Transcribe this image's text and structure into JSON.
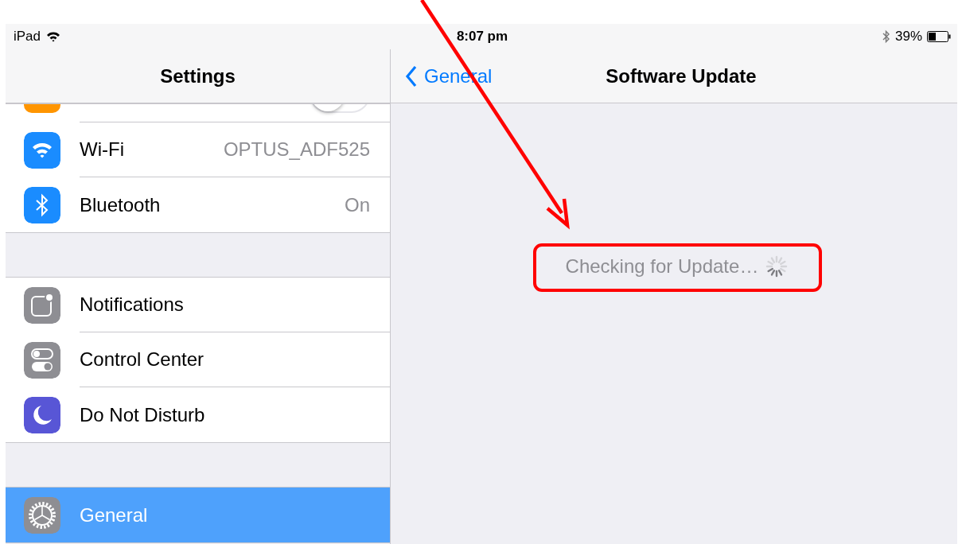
{
  "status_bar": {
    "device": "iPad",
    "time": "8:07 pm",
    "battery": "39%"
  },
  "sidebar": {
    "title": "Settings",
    "groups": [
      [
        {
          "kind": "toggle",
          "on": false
        },
        {
          "kind": "detail",
          "label": "Wi-Fi",
          "value": "OPTUS_ADF525",
          "selected": false
        },
        {
          "kind": "detail",
          "label": "Bluetooth",
          "value": "On",
          "selected": false
        }
      ],
      [
        {
          "kind": "plain",
          "label": "Notifications",
          "selected": false
        },
        {
          "kind": "plain",
          "label": "Control Center",
          "selected": false
        },
        {
          "kind": "plain",
          "label": "Do Not Disturb",
          "selected": false
        }
      ],
      [
        {
          "kind": "plain",
          "label": "General",
          "selected": true
        }
      ]
    ]
  },
  "detail": {
    "back": "General",
    "title": "Software Update",
    "status": "Checking for Update…"
  }
}
